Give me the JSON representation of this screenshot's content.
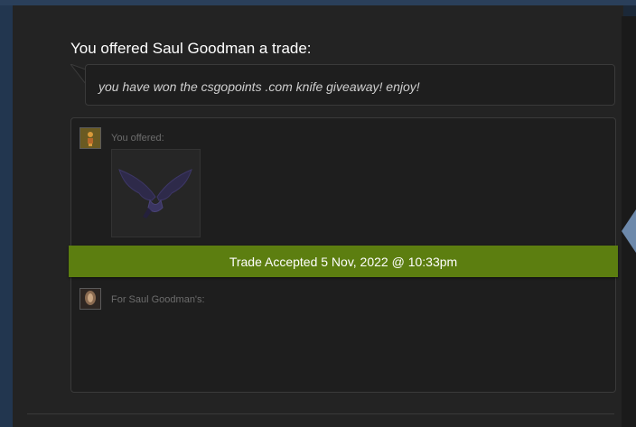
{
  "trade": {
    "title": "You offered Saul Goodman a trade:",
    "message": "you have won the csgopoints .com knife giveaway! enjoy!",
    "you_offered_label": "You offered:",
    "for_label": "For Saul Goodman's:",
    "status_banner": "Trade Accepted 5 Nov, 2022 @ 10:33pm",
    "offered_item_icon": "butterfly-knife-icon"
  },
  "colors": {
    "accepted_banner": "#5c7e10",
    "panel_background": "#232323",
    "page_background": "#1b2838"
  }
}
